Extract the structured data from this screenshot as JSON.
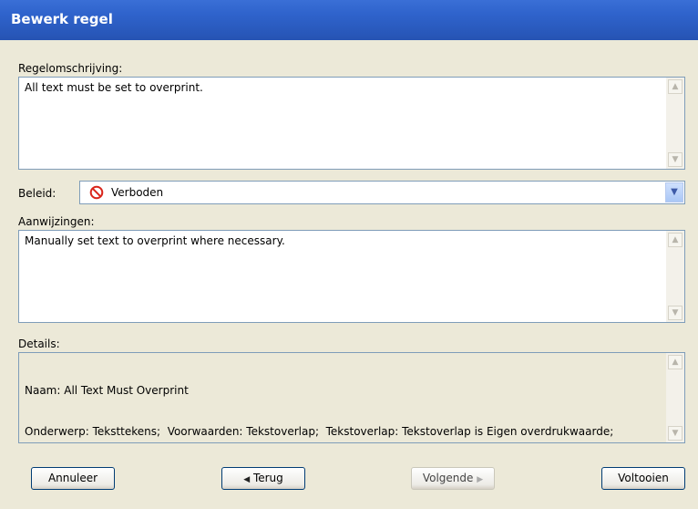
{
  "window": {
    "title": "Bewerk regel"
  },
  "description": {
    "label": "Regelomschrijving:",
    "value": "All text must be set to overprint."
  },
  "policy": {
    "label": "Beleid:",
    "selected": "Verboden",
    "icon": "no-entry-icon",
    "icon_color": "#d9261c"
  },
  "hints": {
    "label": "Aanwijzingen:",
    "value": "Manually set text to overprint where necessary."
  },
  "details": {
    "label": "Details:",
    "line1": "Naam: All Text Must Overprint",
    "line2": "Onderwerp: Teksttekens;  Voorwaarden: Tekstoverlap;  Tekstoverlap: Tekstoverlap is Eigen overdrukwaarde;"
  },
  "buttons": {
    "cancel": "Annuleer",
    "back": "Terug",
    "next": "Volgende",
    "finish": "Voltooien"
  },
  "colors": {
    "titlebar": "#2a5bbf",
    "dialog_bg": "#ece9d8",
    "border": "#7f9db9"
  }
}
